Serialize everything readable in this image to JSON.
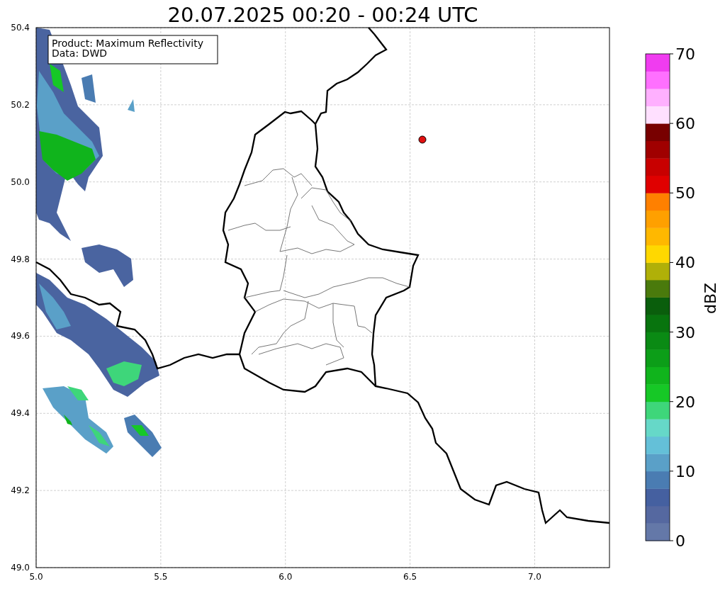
{
  "title": "20.07.2025 00:20 - 00:24 UTC",
  "legend": [
    "Product: Maximum Reflectivity",
    "Data: DWD"
  ],
  "map": {
    "x_ticks": [
      "5.0",
      "5.5",
      "6.0",
      "6.5",
      "7.0"
    ],
    "y_ticks": [
      "50.4",
      "50.2",
      "50.0",
      "49.8",
      "49.6",
      "49.4",
      "49.2",
      "49.0"
    ]
  },
  "colorbar": {
    "label": "dBZ",
    "ticks": [
      "70",
      "60",
      "50",
      "40",
      "30",
      "20",
      "10",
      "0"
    ],
    "levels": [
      {
        "color": "#6478a8"
      },
      {
        "color": "#5568a0"
      },
      {
        "color": "#4560a0"
      },
      {
        "color": "#4a7cb2"
      },
      {
        "color": "#5aa0c8"
      },
      {
        "color": "#64c0d8"
      },
      {
        "color": "#66d8c8"
      },
      {
        "color": "#3ed67a"
      },
      {
        "color": "#16c826"
      },
      {
        "color": "#10b41c"
      },
      {
        "color": "#0c9e18"
      },
      {
        "color": "#0a8a14"
      },
      {
        "color": "#08740e"
      },
      {
        "color": "#0a5e0c"
      },
      {
        "color": "#4a7a0c"
      },
      {
        "color": "#b0b008"
      },
      {
        "color": "#ffd800"
      },
      {
        "color": "#ffb800"
      },
      {
        "color": "#ffa000"
      },
      {
        "color": "#ff8000"
      },
      {
        "color": "#e00000"
      },
      {
        "color": "#c80000"
      },
      {
        "color": "#a00000"
      },
      {
        "color": "#780000"
      },
      {
        "color": "#ffe0ff"
      },
      {
        "color": "#ffb0ff"
      },
      {
        "color": "#ff70ff"
      },
      {
        "color": "#f03cf0"
      }
    ]
  }
}
